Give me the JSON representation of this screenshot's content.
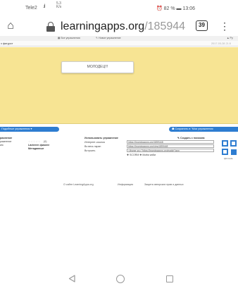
{
  "status_bar": {
    "carrier": "Tele2",
    "signal": ".ıl",
    "network_speed": [
      "5.3",
      "K/s"
    ],
    "right": "⏰ 82 % ▬ 13:06"
  },
  "browser": {
    "url_host": "learningapps.org",
    "url_path": "/185944",
    "tab_count": "39",
    "menu_glyph": "⋮",
    "home_glyph": "⌂"
  },
  "page": {
    "nav_left": "",
    "nav_all_exercises": "▦ Все упражнения",
    "nav_new_exercise": "✎ Новое упражнение",
    "nav_right": "▲ Ру",
    "title": "х фигурот",
    "title_right": "2017-03-28 21:5",
    "game_message": "МОЛОДЕЦ!!!",
    "btn_similar": "Подобные упражнения ▾",
    "btn_save": "☗ Сохранить в \"Мои упражнения",
    "info": {
      "left_label_1": "ражнение",
      "left_label_2": "ражнение",
      "left_label_3": "ию",
      "stars": "☆☆☆☆☆",
      "stars_count": "(0)",
      "fullscreen_label": "Làcteeen фиолее",
      "metadata_label": "Метаданные",
      "use_title": "Использовать упражнение",
      "create_similar": "✎ Создать с похожим",
      "link_label": "Интернет-ссылка",
      "link_value": "https://learningapps.org/1859448",
      "fullscreen2_label": "Во весь экран",
      "fullscreen2_value": "https://learningapps.org/view1859448",
      "embed_label": "Встроить",
      "embed_value": "<iframe src=\"https://learningapps.org/watch?app",
      "scorm": "✚ SCORM  ✚ Моём кабм",
      "qr_label": "QR-Code"
    },
    "footer": {
      "about": "О сайте LearningApps.org",
      "info": "Информация",
      "privacy": "Защита авторских прав и данных"
    }
  },
  "android_nav": {
    "back": "back",
    "home": "home",
    "recent": "recent"
  }
}
